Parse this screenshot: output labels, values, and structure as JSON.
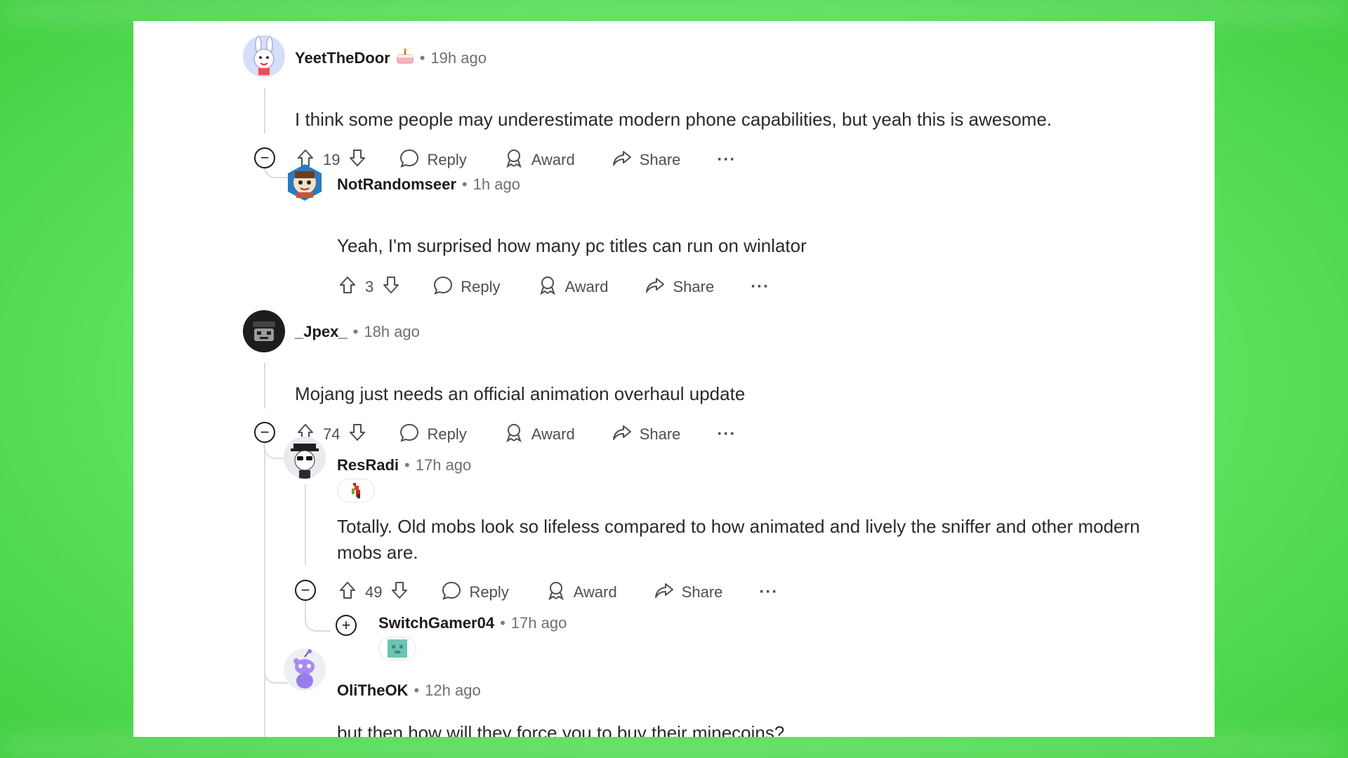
{
  "comments": [
    {
      "author": "YeetTheDoor",
      "time": "19h ago",
      "text": "I think some people may underestimate modern phone capabilities, but yeah this is awesome.",
      "votes": "19",
      "avatar_icon": "bunny-avatar-icon",
      "badge_icon": "cake-day-icon"
    },
    {
      "author": "NotRandomseer",
      "time": "1h ago",
      "text": "Yeah, I'm surprised how many pc titles can run on winlator",
      "votes": "3",
      "avatar_icon": "hexagon-character-avatar-icon"
    },
    {
      "author": "_Jpex_",
      "time": "18h ago",
      "text": "Mojang just needs an official animation overhaul update",
      "votes": "74",
      "avatar_icon": "masked-figure-avatar-icon"
    },
    {
      "author": "ResRadi",
      "time": "17h ago",
      "text": "Totally. Old mobs look so lifeless compared to how animated and lively the sniffer and other modern mobs are.",
      "votes": "49",
      "avatar_icon": "panda-hat-avatar-icon",
      "flair_icon": "pixel-sprite-flair-icon"
    },
    {
      "author": "SwitchGamer04",
      "time": "17h ago",
      "flair_icon": "pixel-block-flair-icon"
    },
    {
      "author": "OliTheOK",
      "time": "12h ago",
      "text": "but then how will they force you to buy their minecoins?",
      "avatar_icon": "snoo-alien-avatar-icon"
    }
  ],
  "actions": {
    "reply": "Reply",
    "award": "Award",
    "share": "Share",
    "more": "···"
  },
  "colors": {
    "background_green": "#5fe35f",
    "card": "#ffffff",
    "thread_line": "#d9dde0",
    "action_text": "#4d4f52"
  }
}
